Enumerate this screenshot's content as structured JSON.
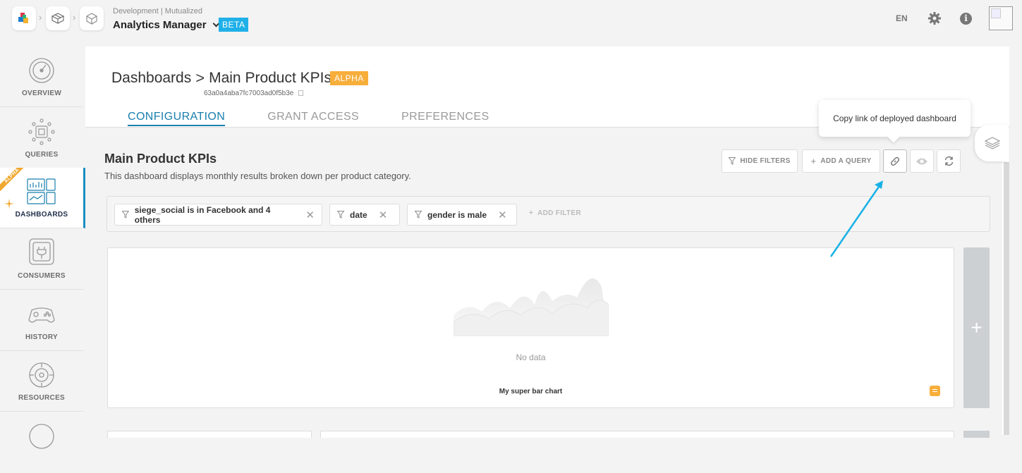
{
  "header": {
    "environment": "Development | Mutualized",
    "app_name": "Analytics Manager",
    "beta_badge": "BETA",
    "language": "EN",
    "info_glyph": "i",
    "icons": [
      "app-logo-icon",
      "cube-outline-icon",
      "cube-app-icon",
      "gear-icon",
      "info-icon",
      "avatar"
    ]
  },
  "sidebar": {
    "items": [
      {
        "label": "OVERVIEW",
        "icon": "speedometer-icon"
      },
      {
        "label": "QUERIES",
        "icon": "chip-icon"
      },
      {
        "label": "DASHBOARDS",
        "icon": "dashboard-icon",
        "active": true,
        "ribbon": "ALPHA"
      },
      {
        "label": "CONSUMERS",
        "icon": "plug-icon"
      },
      {
        "label": "HISTORY",
        "icon": "controller-icon"
      },
      {
        "label": "RESOURCES",
        "icon": "gear-circle-icon"
      }
    ]
  },
  "page": {
    "breadcrumb_root": "Dashboards",
    "breadcrumb_sep": ">",
    "title": "Main Product KPIs",
    "alpha_badge": "ALPHA",
    "id": "63a0a4aba7fc7003ad0f5b3e",
    "tabs": [
      "CONFIGURATION",
      "GRANT ACCESS",
      "PREFERENCES"
    ],
    "active_tab": "CONFIGURATION"
  },
  "dashboard": {
    "title": "Main Product KPIs",
    "description": "This dashboard displays monthly results broken down per product category.",
    "buttons": {
      "hide_filters": "HIDE FILTERS",
      "add_query": "ADD A QUERY",
      "plus": "+"
    },
    "filters": [
      {
        "label": "siege_social is in Facebook and 4 others"
      },
      {
        "label": "date"
      },
      {
        "label": "gender is male"
      }
    ],
    "add_filter": "ADD FILTER",
    "remove_glyph": "✕",
    "card": {
      "empty_text": "No data",
      "name": "My super bar chart"
    },
    "add_column": "+"
  },
  "tooltip": {
    "text": "Copy link of deployed dashboard"
  },
  "colors": {
    "accent": "#1a7fae",
    "beta": "#20b0e8",
    "alpha": "#f7ae3b",
    "arrow": "#19b2e6"
  }
}
